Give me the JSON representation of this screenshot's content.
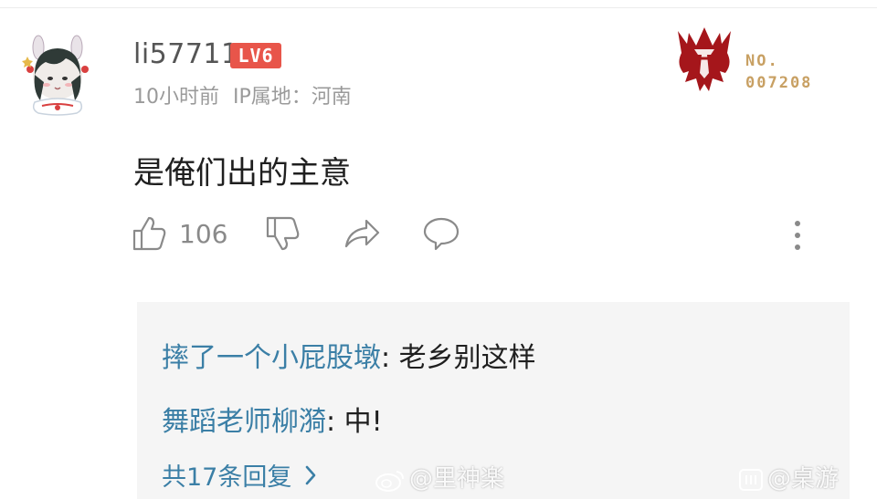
{
  "comment": {
    "username": "li57711",
    "level_badge": "LV6",
    "time": "10小时前",
    "ip_location": "IP属地：河南",
    "medal_no_label": "NO.",
    "medal_number": "007208",
    "text": "是俺们出的主意",
    "likes": "106"
  },
  "replies": {
    "items": [
      {
        "name": "摔了一个小屁股墩",
        "sep": ": ",
        "text": "老乡别这样"
      },
      {
        "name": "舞蹈老师柳漪",
        "sep": ": ",
        "text": "中!"
      }
    ],
    "total_label": "共17条回复"
  },
  "watermarks": {
    "weibo": "@里神楽",
    "other": "@桌游"
  },
  "colors": {
    "level_badge": "#e8554a",
    "reply_name": "#3b7fa6",
    "medal_gold": "#c8a063",
    "horde_red": "#a5161b",
    "reply_bg": "#f5f5f5"
  },
  "icons": {
    "like": "thumbs-up-icon",
    "dislike": "thumbs-down-icon",
    "share": "share-arrow-icon",
    "reply": "speech-bubble-icon",
    "more": "vertical-dots-icon",
    "emblem": "horde-emblem-icon",
    "chevron": "chevron-right-icon"
  }
}
